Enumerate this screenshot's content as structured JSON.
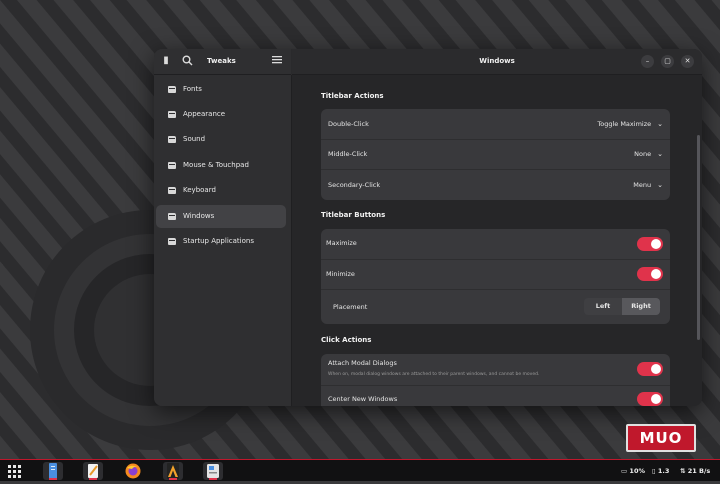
{
  "app": {
    "name": "Tweaks",
    "window_title": "Windows"
  },
  "sidebar": {
    "items": [
      {
        "label": "Fonts",
        "active": false
      },
      {
        "label": "Appearance",
        "active": false
      },
      {
        "label": "Sound",
        "active": false
      },
      {
        "label": "Mouse & Touchpad",
        "active": false
      },
      {
        "label": "Keyboard",
        "active": false
      },
      {
        "label": "Windows",
        "active": true
      },
      {
        "label": "Startup Applications",
        "active": false
      }
    ]
  },
  "titlebar_actions": {
    "title": "Titlebar Actions",
    "rows": [
      {
        "label": "Double-Click",
        "value": "Toggle Maximize"
      },
      {
        "label": "Middle-Click",
        "value": "None"
      },
      {
        "label": "Secondary-Click",
        "value": "Menu"
      }
    ]
  },
  "titlebar_buttons": {
    "title": "Titlebar Buttons",
    "maximize": {
      "label": "Maximize",
      "on": true
    },
    "minimize": {
      "label": "Minimize",
      "on": true
    },
    "placement": {
      "label": "Placement",
      "options": [
        "Left",
        "Right"
      ],
      "selected": "Right"
    }
  },
  "click_actions": {
    "title": "Click Actions",
    "attach_modal": {
      "label": "Attach Modal Dialogs",
      "description": "When on, modal dialog windows are attached to their parent windows, and cannot be moved.",
      "on": true
    },
    "center_new": {
      "label": "Center New Windows",
      "on": true
    }
  },
  "taskbar": {
    "apps": [
      "app-grid-icon",
      "files-icon",
      "text-editor-icon",
      "firefox-icon",
      "inkscape-icon",
      "tweaks-icon"
    ],
    "tray": {
      "battery": "10%",
      "notifications": "1.3",
      "network": "21 B/s"
    }
  },
  "watermark": {
    "text": "MUO"
  },
  "colors": {
    "accent": "#e0334b",
    "taskbar_border": "#c0172c"
  }
}
